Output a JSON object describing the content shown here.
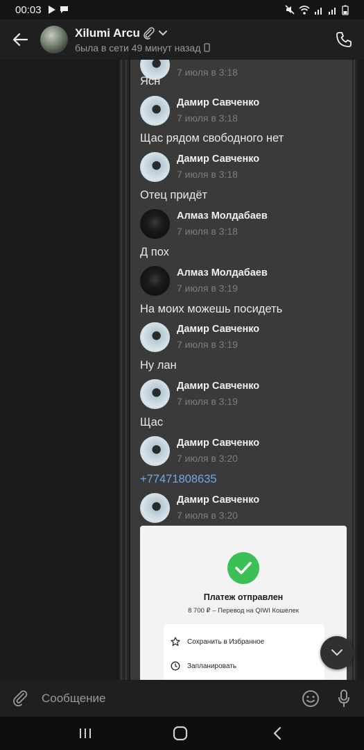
{
  "status_bar": {
    "time": "00:03"
  },
  "header": {
    "title": "Xilumi Arcu",
    "subtitle": "была в сети 49 минут назад"
  },
  "messages": [
    {
      "kind": "date",
      "text": "7 июля в 3:18"
    },
    {
      "kind": "text",
      "text": "Ясн"
    },
    {
      "kind": "author",
      "name": "Дамир Савченко",
      "date": "7 июля в 3:18"
    },
    {
      "kind": "text",
      "text": "Щас рядом свободного нет"
    },
    {
      "kind": "author",
      "name": "Дамир Савченко",
      "date": "7 июля в 3:18"
    },
    {
      "kind": "text",
      "text": "Отец придёт"
    },
    {
      "kind": "author",
      "name": "Алмаз Молдабаев",
      "date": "7 июля в 3:18"
    },
    {
      "kind": "text",
      "text": "Д пох"
    },
    {
      "kind": "author",
      "name": "Алмаз Молдабаев",
      "date": "7 июля в 3:19"
    },
    {
      "kind": "text",
      "text": "На моих можешь посидеть"
    },
    {
      "kind": "author",
      "name": "Дамир Савченко",
      "date": "7 июля в 3:19"
    },
    {
      "kind": "text",
      "text": "Ну лан"
    },
    {
      "kind": "author",
      "name": "Дамир Савченко",
      "date": "7 июля в 3:19"
    },
    {
      "kind": "text",
      "text": "Щас"
    },
    {
      "kind": "author",
      "name": "Дамир Савченко",
      "date": "7 июля в 3:20"
    },
    {
      "kind": "link",
      "text": "+77471808635"
    },
    {
      "kind": "author",
      "name": "Дамир Савченко",
      "date": "7 июля в 3:20"
    }
  ],
  "payment_card": {
    "title": "Платеж отправлен",
    "subtitle": "8 700 ₽ – Перевод на QIWI Кошелек",
    "actions": [
      "Сохранить в Избранное",
      "Запланировать"
    ]
  },
  "compose": {
    "placeholder": "Сообщение"
  },
  "colors": {
    "accent_link": "#71a8e6",
    "success": "#3dbf57",
    "bubble": "#3a3a3b"
  }
}
